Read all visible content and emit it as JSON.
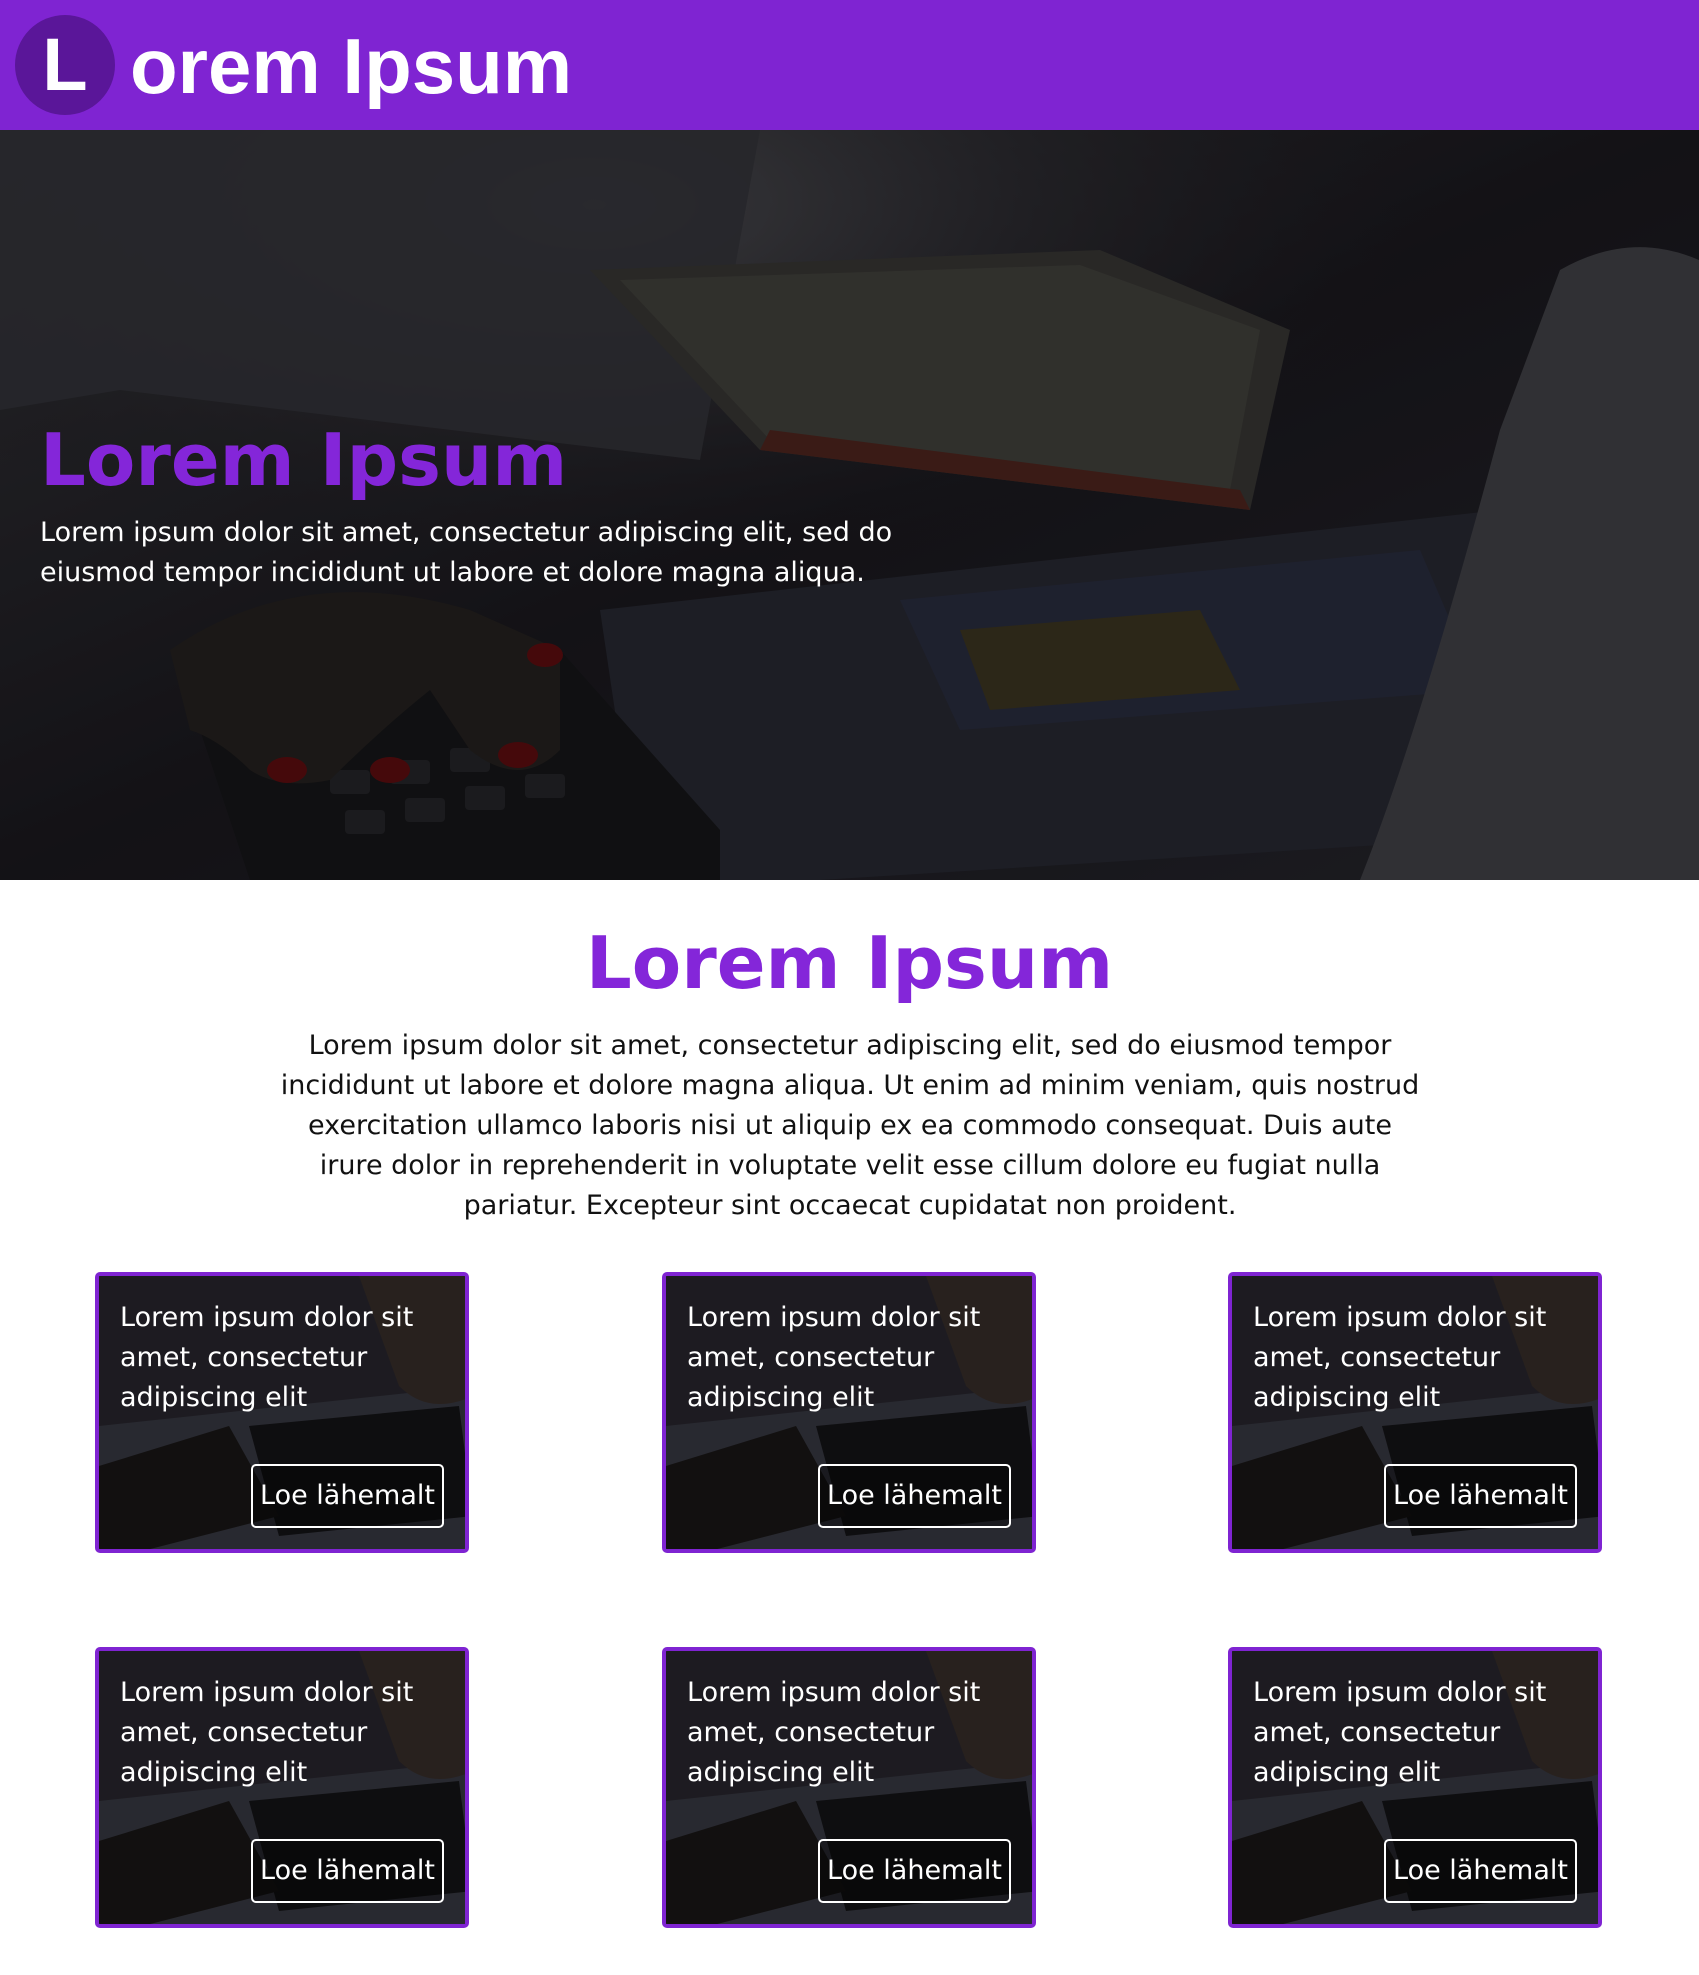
{
  "header": {
    "logo_letter": "L",
    "logo_text": "orem Ipsum",
    "bg_color": "#7f24d2"
  },
  "hero": {
    "title": "Lorem Ipsum",
    "text": "Lorem ipsum dolor sit amet, consectetur adipiscing elit, sed do eiusmod tempor incididunt ut labore et dolore magna aliqua.",
    "image": "dark-office-desk-photo-hands-calculator-book"
  },
  "intro": {
    "title": "Lorem Ipsum",
    "text": "Lorem ipsum dolor sit amet, consectetur adipiscing elit, sed do eiusmod tempor incididunt ut labore et dolore magna aliqua. Ut enim ad minim veniam, quis nostrud exercitation ullamco laboris nisi ut aliquip ex ea commodo consequat. Duis aute irure dolor in reprehenderit in voluptate velit esse cillum dolore eu fugiat nulla pariatur. Excepteur sint occaecat cupidatat non proident."
  },
  "cards": [
    {
      "text": "Lorem ipsum dolor sit amet, consectetur adipiscing elit",
      "button": "Loe lähemalt"
    },
    {
      "text": "Lorem ipsum dolor sit amet, consectetur adipiscing elit",
      "button": "Loe lähemalt"
    },
    {
      "text": "Lorem ipsum dolor sit amet, consectetur adipiscing elit",
      "button": "Loe lähemalt"
    },
    {
      "text": "Lorem ipsum dolor sit amet, consectetur adipiscing elit",
      "button": "Loe lähemalt"
    },
    {
      "text": "Lorem ipsum dolor sit amet, consectetur adipiscing elit",
      "button": "Loe lähemalt"
    },
    {
      "text": "Lorem ipsum dolor sit amet, consectetur adipiscing elit",
      "button": "Loe lähemalt"
    }
  ],
  "colors": {
    "accent": "#8426d9",
    "border": "#7f24d2"
  }
}
